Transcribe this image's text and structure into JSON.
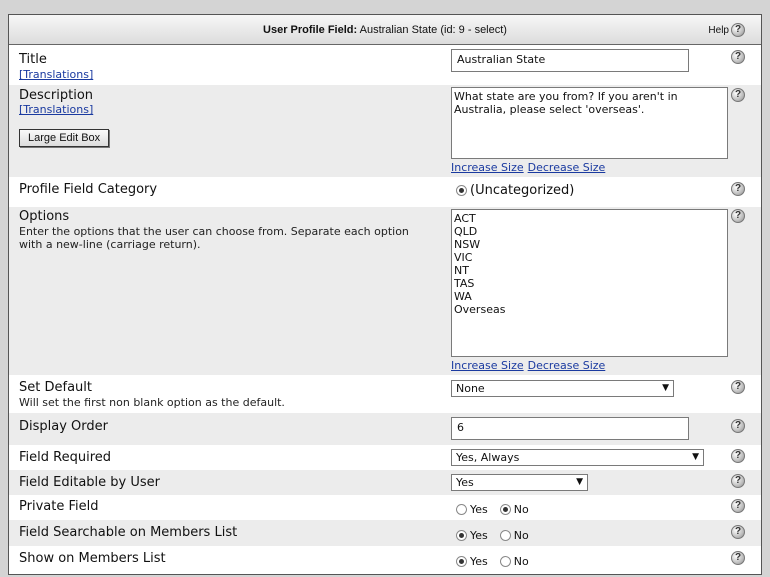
{
  "header": {
    "title_bold": "User Profile Field:",
    "title_rest": " Australian State (id: 9 - select)",
    "help_label": "Help",
    "help_icon": "?"
  },
  "fields": {
    "title": {
      "label": "Title",
      "link": "[Translations]",
      "value": "Australian State"
    },
    "description": {
      "label": "Description",
      "link": "[Translations]",
      "button": "Large Edit Box",
      "value": "What state are you from? If you aren't in\nAustralia, please select 'overseas'.",
      "increase": "Increase Size",
      "decrease": "Decrease Size"
    },
    "category": {
      "label": "Profile Field Category",
      "option": "(Uncategorized)"
    },
    "options": {
      "label": "Options",
      "desc_line1": "Enter the options that the user can choose from. Separate each option",
      "desc_line2": "with a new-line (carriage return).",
      "value": "ACT\nQLD\nNSW\nVIC\nNT\nTAS\nWA\nOverseas",
      "increase": "Increase Size",
      "decrease": "Decrease Size"
    },
    "set_default": {
      "label": "Set Default",
      "desc": "Will set the first non blank option as the default.",
      "value": "None"
    },
    "display_order": {
      "label": "Display Order",
      "value": "6"
    },
    "required": {
      "label": "Field Required",
      "value": "Yes, Always"
    },
    "editable": {
      "label": "Field Editable by User",
      "value": "Yes"
    },
    "private": {
      "label": "Private Field",
      "yes": "Yes",
      "no": "No",
      "selected": "No"
    },
    "searchable": {
      "label": "Field Searchable on Members List",
      "yes": "Yes",
      "no": "No",
      "selected": "Yes"
    },
    "show_list": {
      "label": "Show on Members List",
      "yes": "Yes",
      "no": "No",
      "selected": "Yes"
    }
  },
  "help_icon": "?"
}
